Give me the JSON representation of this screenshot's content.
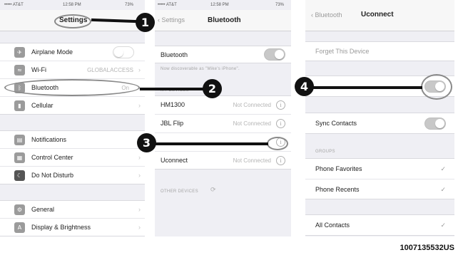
{
  "panel1": {
    "status": {
      "carrier": "••••• AT&T",
      "time": "12:58 PM",
      "battery": "73%"
    },
    "title": "Settings",
    "groups": [
      [
        {
          "icon": "airplane-icon",
          "label": "Airplane Mode",
          "toggle": "off"
        },
        {
          "icon": "wifi-icon",
          "label": "Wi-Fi",
          "value": "GLOBALACCESS"
        },
        {
          "icon": "bluetooth-icon",
          "label": "Bluetooth",
          "value": "On"
        },
        {
          "icon": "cellular-icon",
          "label": "Cellular"
        }
      ],
      [
        {
          "icon": "notifications-icon",
          "label": "Notifications"
        },
        {
          "icon": "control-center-icon",
          "label": "Control Center"
        },
        {
          "icon": "do-not-disturb-icon",
          "label": "Do Not Disturb"
        }
      ],
      [
        {
          "icon": "general-icon",
          "label": "General"
        },
        {
          "icon": "display-brightness-icon",
          "label": "Display & Brightness"
        }
      ]
    ]
  },
  "panel2": {
    "status": {
      "carrier": "••••• AT&T",
      "time": "12:58 PM",
      "battery": "73%"
    },
    "back": "Settings",
    "title": "Bluetooth",
    "bluetooth_label": "Bluetooth",
    "discoverable_note": "Now discoverable as \"Mike's iPhone\".",
    "my_devices_header": "MY DEVICES",
    "devices": [
      {
        "name": "HM1300",
        "status": "Not Connected"
      },
      {
        "name": "JBL Flip",
        "status": "Not Connected"
      },
      {
        "name": "",
        "status": ""
      },
      {
        "name": "Uconnect",
        "status": "Not Connected"
      }
    ],
    "other_devices_header": "OTHER DEVICES"
  },
  "panel3": {
    "back": "Bluetooth",
    "title": "Uconnect",
    "forget_label": "Forget This Device",
    "sync_contacts_label": "Sync Contacts",
    "groups_header": "GROUPS",
    "groups": [
      {
        "label": "Phone Favorites",
        "checked": true
      },
      {
        "label": "Phone Recents",
        "checked": true
      }
    ],
    "all_contacts": {
      "label": "All Contacts",
      "checked": true
    }
  },
  "callouts": [
    "1",
    "2",
    "3",
    "4"
  ],
  "reference_code": "1007135532US",
  "colors": {
    "callout": "#111111",
    "background": "#efeff4",
    "toggle_on": "#c8c8c8"
  }
}
